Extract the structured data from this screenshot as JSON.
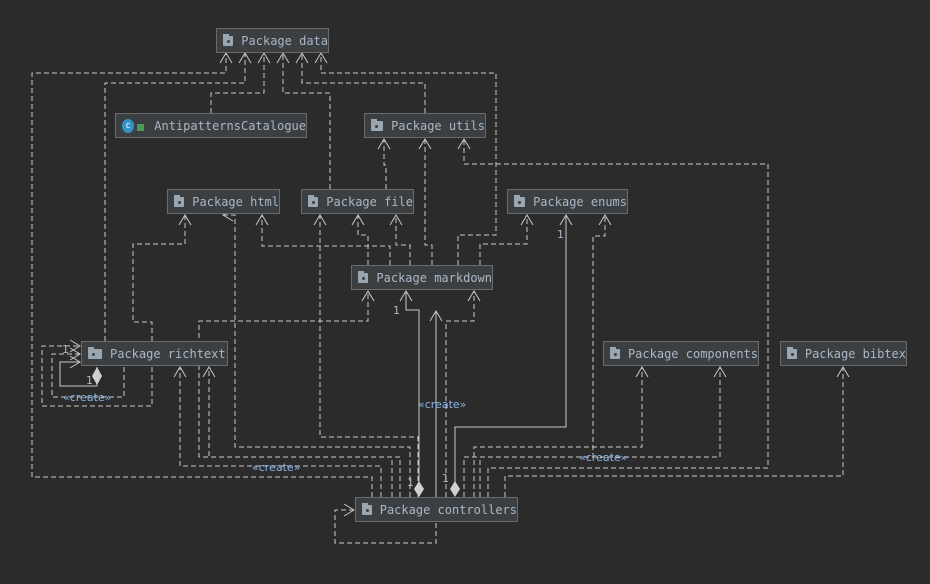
{
  "nodes": {
    "data": "Package data",
    "antipatterns": "AntipatternsCatalogue",
    "utils": "Package utils",
    "html": "Package html",
    "file": "Package file",
    "enums": "Package enums",
    "markdown": "Package markdown",
    "richtext": "Package richtext",
    "components": "Package components",
    "bibtex": "Package bibtex",
    "controllers": "Package controllers"
  },
  "labels": {
    "one": "1",
    "create": "«create»"
  },
  "colors": {
    "background": "#2b2b2b",
    "node": "#3c3f41",
    "edge": "#c8c8c8",
    "text": "#a9b7c6",
    "create": "#8ab4e8"
  }
}
